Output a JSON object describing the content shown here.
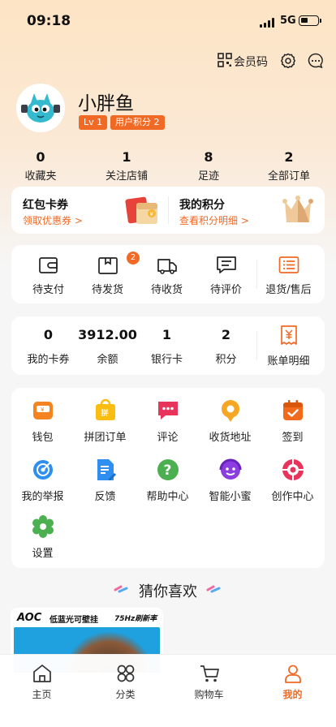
{
  "status_bar": {
    "time": "09:18",
    "network": "5G"
  },
  "header": {
    "member_code": "会员码"
  },
  "profile": {
    "username": "小胖鱼",
    "level": "Lv 1",
    "points_badge": "用户积分 2"
  },
  "stats": [
    {
      "value": "0",
      "label": "收藏夹"
    },
    {
      "value": "1",
      "label": "关注店铺"
    },
    {
      "value": "8",
      "label": "足迹"
    },
    {
      "value": "2",
      "label": "全部订单"
    }
  ],
  "promo": {
    "coupon_title": "红包卡券",
    "coupon_link": "领取优惠券 >",
    "points_title": "我的积分",
    "points_link": "查看积分明细 >"
  },
  "orders": [
    {
      "label": "待支付",
      "icon": "wallet-icon"
    },
    {
      "label": "待发货",
      "icon": "package-icon",
      "badge": "2"
    },
    {
      "label": "待收货",
      "icon": "truck-icon"
    },
    {
      "label": "待评价",
      "icon": "comment-icon"
    },
    {
      "label": "退货/售后",
      "icon": "return-list-icon"
    }
  ],
  "assets": [
    {
      "value": "0",
      "label": "我的卡券"
    },
    {
      "value": "3912.00",
      "label": "余额"
    },
    {
      "value": "1",
      "label": "银行卡"
    },
    {
      "value": "2",
      "label": "积分"
    }
  ],
  "bill": {
    "label": "账单明细",
    "icon": "bill-icon"
  },
  "tools": [
    {
      "label": "钱包",
      "icon": "wallet-icon",
      "color": "#f5831f"
    },
    {
      "label": "拼团订单",
      "icon": "group-order-icon",
      "color": "#fbbd12"
    },
    {
      "label": "评论",
      "icon": "comment-icon",
      "color": "#e8335a"
    },
    {
      "label": "收货地址",
      "icon": "location-icon",
      "color": "#f5a623"
    },
    {
      "label": "签到",
      "icon": "calendar-check-icon",
      "color": "#f26a1b"
    },
    {
      "label": "我的举报",
      "icon": "report-icon",
      "color": "#2f8ff0"
    },
    {
      "label": "反馈",
      "icon": "feedback-icon",
      "color": "#2f8ff0"
    },
    {
      "label": "帮助中心",
      "icon": "help-icon",
      "color": "#4caf50"
    },
    {
      "label": "智能小蜜",
      "icon": "assistant-icon",
      "color": "#8b3de0"
    },
    {
      "label": "创作中心",
      "icon": "create-icon",
      "color": "#e8335a"
    },
    {
      "label": "设置",
      "icon": "settings-icon",
      "color": "#4caf50"
    }
  ],
  "recommend": {
    "title": "猜你喜欢",
    "product_brand": "AOC",
    "product_tag": "低蓝光可壁挂",
    "product_spec": "75Hz刷新率"
  },
  "tabbar": [
    {
      "label": "主页",
      "icon": "home-icon"
    },
    {
      "label": "分类",
      "icon": "category-icon"
    },
    {
      "label": "购物车",
      "icon": "cart-icon"
    },
    {
      "label": "我的",
      "icon": "user-icon",
      "active": true
    }
  ],
  "watermark": "",
  "colors": {
    "accent": "#f06a25",
    "active_tab": "#f06a25"
  }
}
